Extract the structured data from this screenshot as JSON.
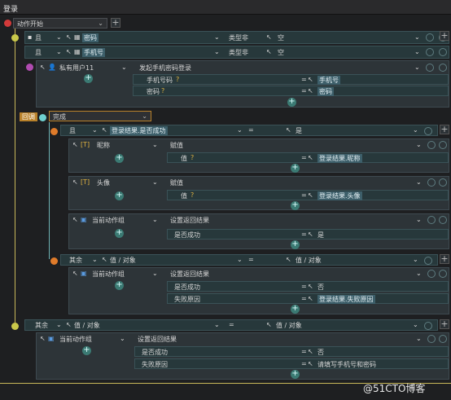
{
  "window": {
    "title": "登录"
  },
  "root": {
    "label": "动作开始"
  },
  "cond1": {
    "op": "且",
    "field": "密码",
    "type": "类型非",
    "value": "空"
  },
  "cond2": {
    "op": "且",
    "field": "手机号",
    "type": "类型非",
    "value": "空"
  },
  "action1": {
    "object": "私有用户11",
    "method": "发起手机密码登录",
    "params": [
      {
        "name": "手机号码",
        "eq": "=",
        "value": "手机号"
      },
      {
        "name": "密码",
        "eq": "=",
        "value": "密码"
      }
    ]
  },
  "callback": {
    "tag": "回调",
    "label": "完成"
  },
  "cond3": {
    "op": "且",
    "field": "登录结果.是否成功",
    "eq": "=",
    "value": "是"
  },
  "nick": {
    "object": "昵称",
    "method": "赋值",
    "param": "值",
    "eq": "=",
    "value": "登录结果.昵称"
  },
  "avatar": {
    "object": "头像",
    "method": "赋值",
    "param": "值",
    "eq": "=",
    "value": "登录结果.头像"
  },
  "ret1": {
    "object": "当前动作组",
    "method": "设置返回结果",
    "param": "是否成功",
    "eq": "=",
    "value": "是"
  },
  "else1": {
    "op": "其余",
    "field": "值 / 对象",
    "eq": "=",
    "value": "值 / 对象"
  },
  "ret2": {
    "object": "当前动作组",
    "method": "设置返回结果",
    "params": [
      {
        "name": "是否成功",
        "eq": "=",
        "value": "否"
      },
      {
        "name": "失败原因",
        "eq": "=",
        "value": "登录结果.失败原因"
      }
    ]
  },
  "else2": {
    "op": "其余",
    "field": "值 / 对象",
    "eq": "=",
    "value": "值 / 对象"
  },
  "ret3": {
    "object": "当前动作组",
    "method": "设置返回结果",
    "params": [
      {
        "name": "是否成功",
        "eq": "=",
        "value": "否"
      },
      {
        "name": "失败原因",
        "eq": "=",
        "value": "请填写手机号和密码"
      }
    ]
  },
  "watermark": "@51CTO博客",
  "colors": {
    "accent": "#c9b85a",
    "teal": "#3b7a73",
    "orange": "#e07b2a",
    "magenta": "#b04bb0"
  }
}
